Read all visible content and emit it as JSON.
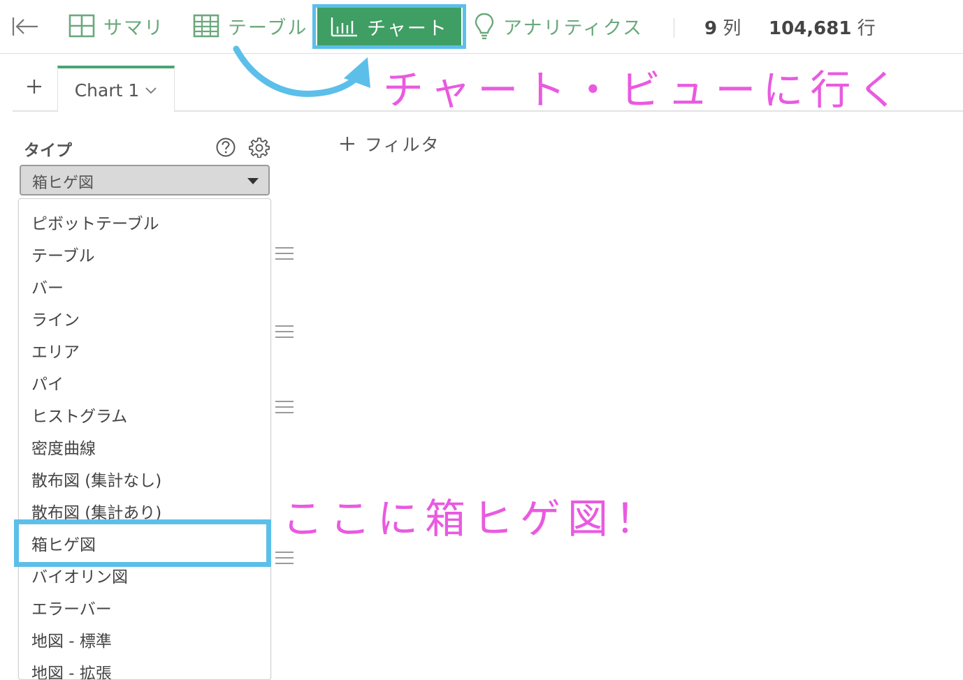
{
  "toolbar": {
    "summary_label": "サマリ",
    "table_label": "テーブル",
    "chart_label": "チャート",
    "analytics_label": "アナリティクス",
    "columns_count": "9",
    "columns_unit": "列",
    "rows_count": "104,681",
    "rows_unit": "行"
  },
  "tabs": {
    "items": [
      {
        "label": "Chart 1",
        "active": true
      }
    ]
  },
  "panel": {
    "type_label": "タイプ",
    "selected_type": "箱ヒゲ図",
    "options": [
      "ピボットテーブル",
      "テーブル",
      "バー",
      "ライン",
      "エリア",
      "パイ",
      "ヒストグラム",
      "密度曲線",
      "散布図 (集計なし)",
      "散布図 (集計あり)",
      "箱ヒゲ図",
      "バイオリン図",
      "エラーバー",
      "地図 - 標準",
      "地図 - 拡張"
    ]
  },
  "filter": {
    "label": "フィルタ"
  },
  "annotations": {
    "go_to_chart": "チャート・ビューに行く",
    "boxplot_here": "ここに箱ヒゲ図！"
  },
  "colors": {
    "brand_green": "#4aa472",
    "highlight_blue": "#5bbfe9",
    "annotation_pink": "#e95ae0"
  },
  "icons": {
    "back": "collapse-left-icon",
    "summary": "grid-icon",
    "table": "table-icon",
    "chart": "bar-chart-icon",
    "analytics": "lightbulb-icon",
    "help": "question-icon",
    "settings": "gear-icon",
    "add": "plus-icon"
  }
}
